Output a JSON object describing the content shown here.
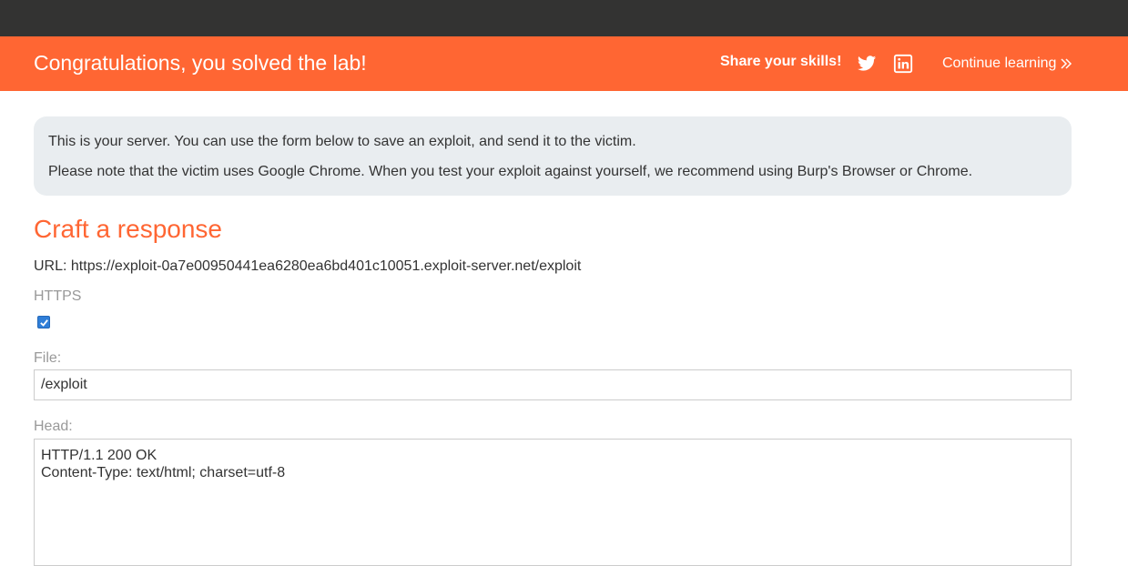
{
  "banner": {
    "title": "Congratulations, you solved the lab!",
    "share_label": "Share your skills!",
    "twitter_icon": "twitter-icon",
    "linkedin_icon": "linkedin-icon",
    "continue_label": "Continue learning",
    "continue_icon": "double-chevron-right-icon"
  },
  "notice": {
    "line1": "This is your server. You can use the form below to save an exploit, and send it to the victim.",
    "line2": "Please note that the victim uses Google Chrome. When you test your exploit against yourself, we recommend using Burp's Browser or Chrome."
  },
  "form": {
    "heading": "Craft a response",
    "url_line": "URL: https://exploit-0a7e00950441ea6280ea6bd401c10051.exploit-server.net/exploit",
    "https_label": "HTTPS",
    "https_checked": true,
    "file_label": "File:",
    "file_value": "/exploit",
    "head_label": "Head:",
    "head_value": "HTTP/1.1 200 OK\nContent-Type: text/html; charset=utf-8"
  },
  "colors": {
    "topbar": "#333332",
    "accent": "#ff6633",
    "notice_bg": "#e9edf0",
    "checkbox": "#2f7ed8"
  }
}
